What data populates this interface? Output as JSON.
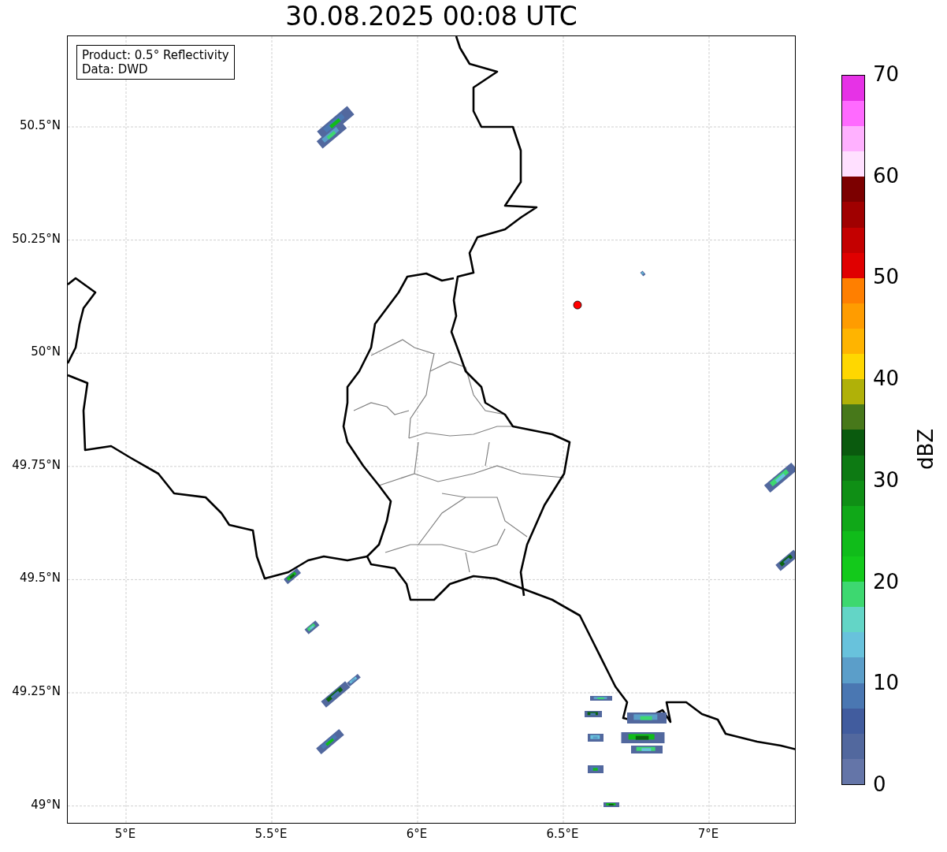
{
  "title": "30.08.2025 00:08 UTC",
  "info_box": [
    "Product: 0.5° Reflectivity",
    "Data: DWD"
  ],
  "lat_ticks": [
    "50.5°N",
    "50.25°N",
    "50°N",
    "49.75°N",
    "49.5°N",
    "49.25°N",
    "49°N"
  ],
  "lon_ticks": [
    "5°E",
    "5.5°E",
    "6°E",
    "6.5°E",
    "7°E"
  ],
  "colorbar": {
    "label": "dBZ",
    "ticks": [
      "70",
      "60",
      "50",
      "40",
      "30",
      "20",
      "10",
      "0"
    ],
    "bands": [
      {
        "color": "#6475a8"
      },
      {
        "color": "#52689e"
      },
      {
        "color": "#415c9e"
      },
      {
        "color": "#4a77b2"
      },
      {
        "color": "#5b9ec9"
      },
      {
        "color": "#68c2dc"
      },
      {
        "color": "#63d5c6"
      },
      {
        "color": "#3dd870"
      },
      {
        "color": "#13c91b"
      },
      {
        "color": "#10bc1a"
      },
      {
        "color": "#10a818"
      },
      {
        "color": "#0f8f15"
      },
      {
        "color": "#0d7a13"
      },
      {
        "color": "#0a5a0e"
      },
      {
        "color": "#47781a"
      },
      {
        "color": "#b0b108"
      },
      {
        "color": "#ffd700"
      },
      {
        "color": "#ffb400"
      },
      {
        "color": "#ff9c00"
      },
      {
        "color": "#ff7f00"
      },
      {
        "color": "#e00000"
      },
      {
        "color": "#c40000"
      },
      {
        "color": "#a00000"
      },
      {
        "color": "#7c0000"
      },
      {
        "color": "#ffe0ff"
      },
      {
        "color": "#ffb1ff"
      },
      {
        "color": "#ff6aff"
      },
      {
        "color": "#e632e6"
      }
    ]
  }
}
